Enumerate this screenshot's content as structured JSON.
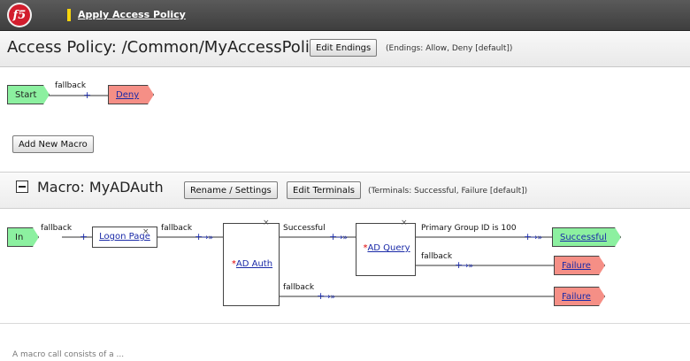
{
  "topbar": {
    "logo": "f5",
    "title": "Apply Access Policy"
  },
  "header": {
    "title": "Access Policy: /Common/MyAccessPolicy",
    "edit_endings": "Edit Endings",
    "endings_note": "(Endings: Allow, Deny [default])"
  },
  "main_flow": {
    "start": "Start",
    "fallback": "fallback",
    "deny": "Deny"
  },
  "add_macro": "Add New Macro",
  "macro": {
    "title": "Macro: MyADAuth",
    "rename": "Rename / Settings",
    "edit_terminals": "Edit Terminals",
    "terminals_note": "(Terminals: Successful, Failure [default])",
    "in": "In",
    "logon_page": "Logon Page",
    "ad_auth": "AD Auth",
    "ad_query": "AD Query",
    "req": "*",
    "close": "×",
    "plus": "+",
    "arrow": "→»",
    "labels": {
      "fallback": "fallback",
      "successful": "Successful",
      "primary_group": "Primary Group ID is 100"
    },
    "successful": "Successful",
    "failure": "Failure"
  },
  "footer_text": "A macro call consists of a ..."
}
